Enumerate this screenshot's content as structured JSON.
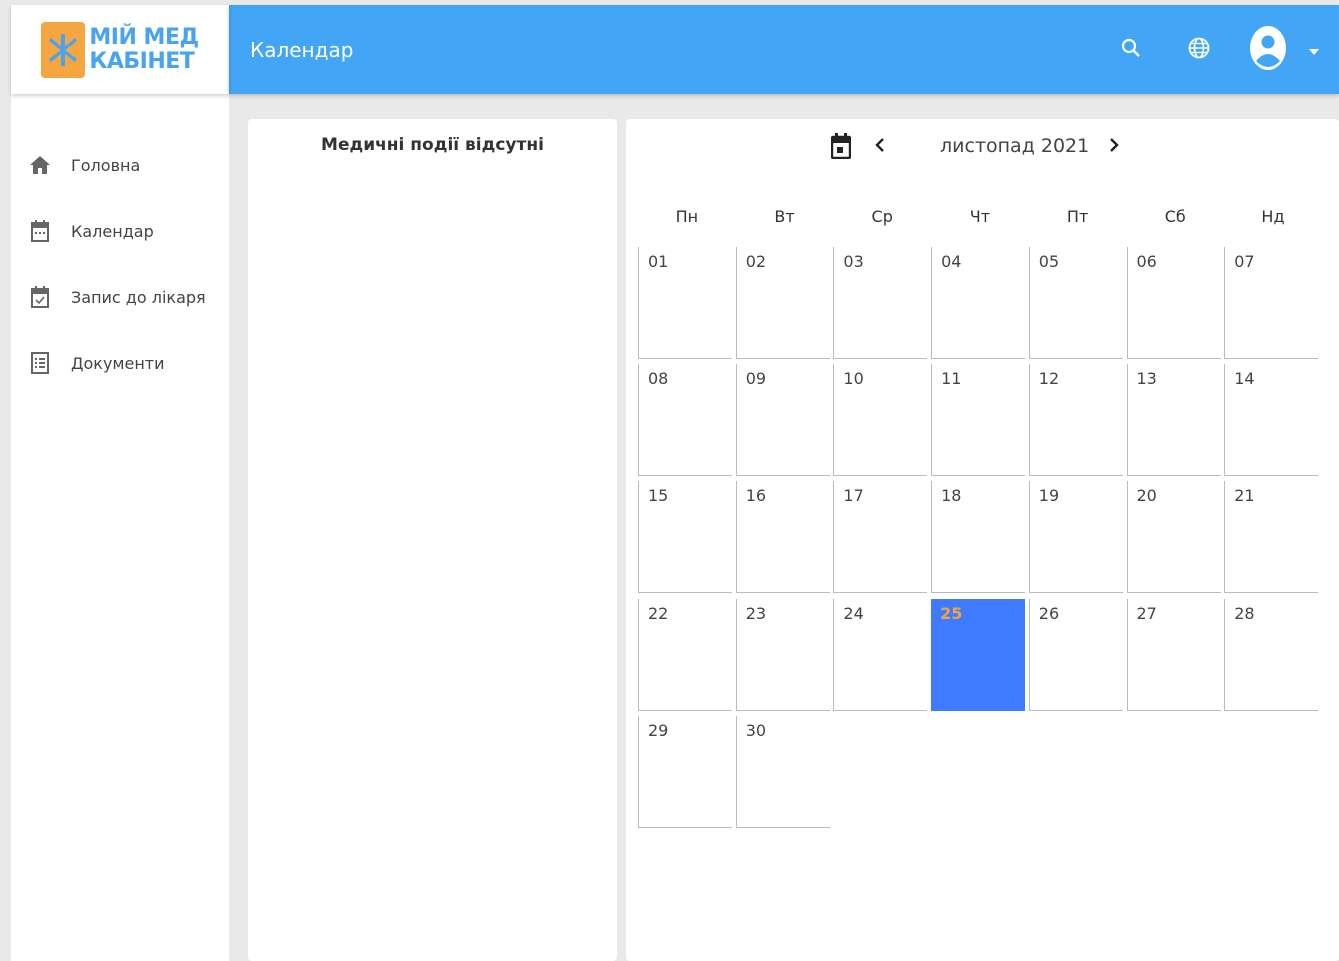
{
  "app": {
    "logo_line1": "МІЙ МЕД",
    "logo_line2": "КАБІНЕТ",
    "logo_color": "#f4a640"
  },
  "header": {
    "title": "Календар",
    "bg_color": "#43a5f5",
    "icons": [
      "search-icon",
      "globe-icon",
      "account-icon",
      "caret-down-icon"
    ]
  },
  "sidebar": {
    "items": [
      {
        "label": "Головна",
        "icon": "home-icon"
      },
      {
        "label": "Календар",
        "icon": "calendar-icon"
      },
      {
        "label": "Запис до лікаря",
        "icon": "calendar-check-icon"
      },
      {
        "label": "Документи",
        "icon": "document-list-icon"
      }
    ]
  },
  "events": {
    "empty_text": "Медичні події відсутні"
  },
  "calendar": {
    "month_label": "листопад 2021",
    "weekdays": [
      "Пн",
      "Вт",
      "Ср",
      "Чт",
      "Пт",
      "Сб",
      "Нд"
    ],
    "days": [
      "01",
      "02",
      "03",
      "04",
      "05",
      "06",
      "07",
      "08",
      "09",
      "10",
      "11",
      "12",
      "13",
      "14",
      "15",
      "16",
      "17",
      "18",
      "19",
      "20",
      "21",
      "22",
      "23",
      "24",
      "25",
      "26",
      "27",
      "28",
      "29",
      "30"
    ],
    "today": "25",
    "today_bg": "#3f7bff",
    "today_text_color": "#f2a33c"
  }
}
